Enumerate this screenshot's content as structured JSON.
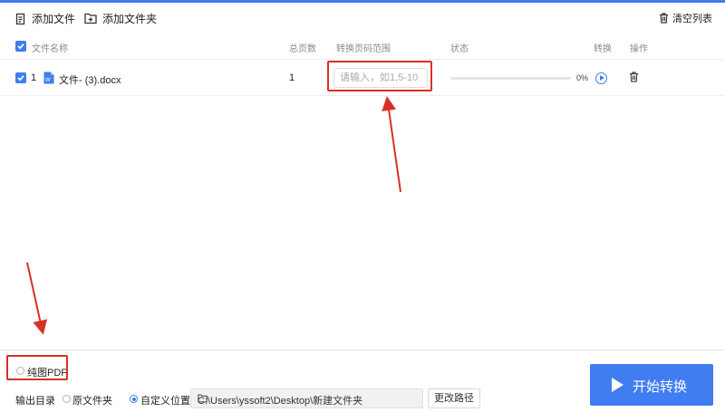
{
  "toolbar": {
    "add_file_label": "添加文件",
    "add_folder_label": "添加文件夹",
    "clear_list_label": "清空列表"
  },
  "table": {
    "headers": {
      "name": "文件名称",
      "pages": "总页数",
      "range": "转换页码范围",
      "status": "状态",
      "convert": "转换",
      "action": "操作"
    },
    "rows": [
      {
        "index": "1",
        "name": "文件- (3).docx",
        "pages": "1",
        "range_value": "",
        "range_placeholder": "请输入，如1,5-10",
        "progress": 0,
        "progress_text": "0%",
        "checked": true
      }
    ]
  },
  "bottom": {
    "pure_image_pdf_label": "纯图PDF",
    "output_dir_label": "输出目录",
    "original_folder_label": "原文件夹",
    "custom_location_label": "自定义位置",
    "output_path": "C:\\Users\\yssoft2\\Desktop\\新建文件夹",
    "change_path_label": "更改路径",
    "start_label": "开始转换"
  },
  "colors": {
    "accent": "#3f7df0",
    "highlight": "#d93025"
  },
  "icons": {
    "add_file": "add-file-icon",
    "add_folder": "add-folder-icon",
    "clear": "trash-icon",
    "file_type": "word-file-icon",
    "convert": "play-icon",
    "delete": "trash-icon",
    "browse": "folder-icon",
    "start": "play-icon"
  }
}
